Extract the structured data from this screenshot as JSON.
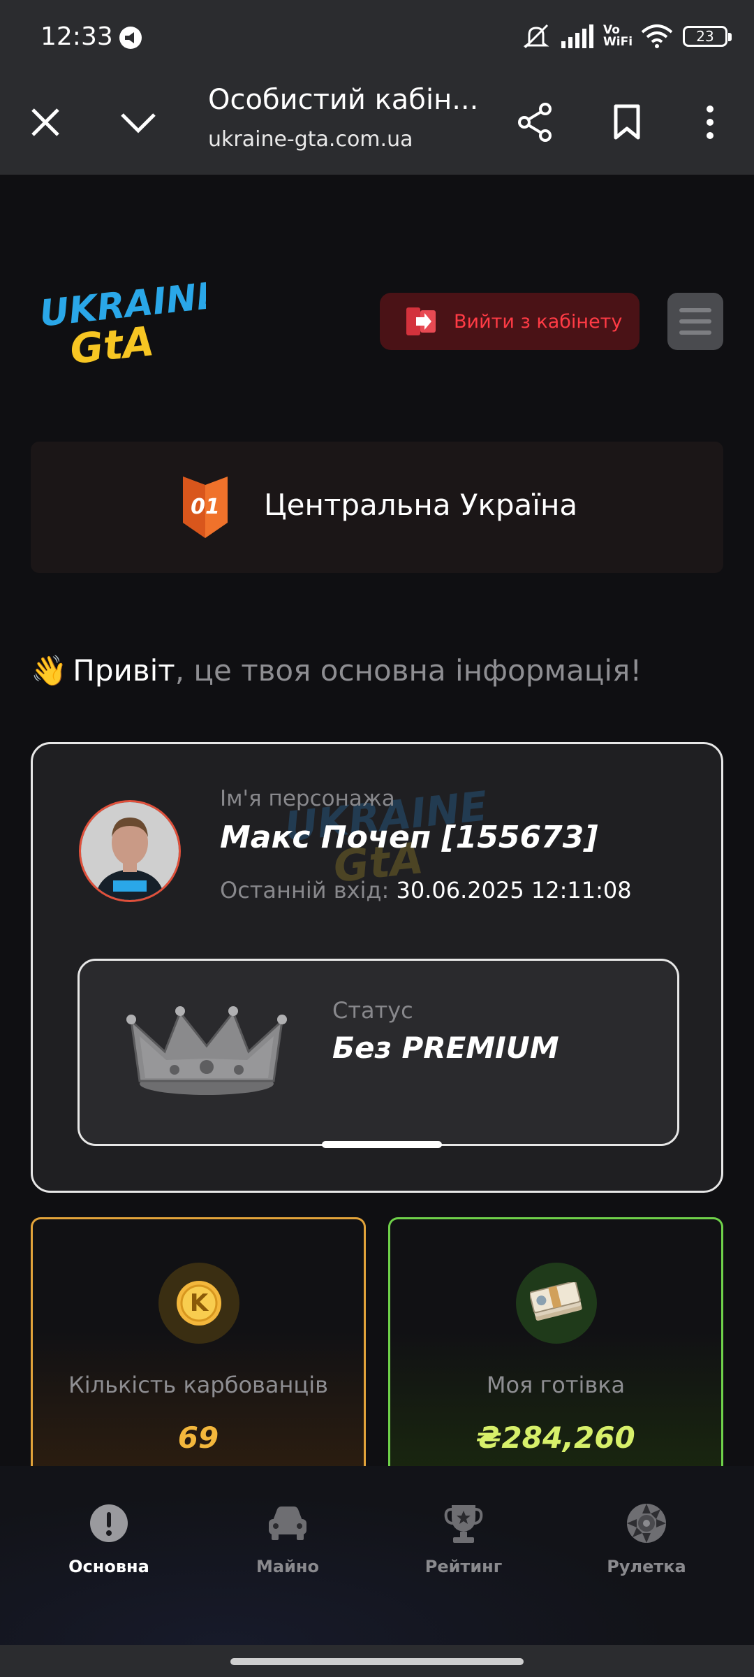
{
  "status_bar": {
    "time": "12:33",
    "battery": "23",
    "network_label": "Vo WiFi"
  },
  "browser": {
    "title": "Особистий кабін...",
    "url": "ukraine-gta.com.ua",
    "icons": [
      "close-icon",
      "chevron-down-icon",
      "share-icon",
      "bookmark-icon",
      "more-vert-icon"
    ]
  },
  "header": {
    "logo_text": [
      "UKRAINE",
      "GTA"
    ],
    "logout_label": "Вийти з кабінету",
    "logout_color": "#ff3b45"
  },
  "server": {
    "badge_number": "01",
    "name": "Центральна Україна"
  },
  "greeting": {
    "emoji": "👋",
    "strong": "Привіт",
    "rest": ", це твоя основна інформація!"
  },
  "profile": {
    "character_label": "Ім'я персонажа",
    "character_name": "Макс Почеп [155673]",
    "last_login_label": "Останній вхід:",
    "last_login_value": "30.06.2025 12:11:08",
    "status_label": "Статус",
    "status_value": "Без PREMIUM"
  },
  "stats": {
    "karbovantsi": {
      "label": "Кількість карбованців",
      "value": "69",
      "icon_letter": "K",
      "accent": "#e2a33a"
    },
    "cash": {
      "label": "Моя готівка",
      "value": "₴284,260",
      "accent": "#6fd14a"
    }
  },
  "bottom_nav": {
    "items": [
      {
        "label": "Основна",
        "icon": "info-icon",
        "active": true
      },
      {
        "label": "Майно",
        "icon": "car-icon",
        "active": false
      },
      {
        "label": "Рейтинг",
        "icon": "trophy-icon",
        "active": false
      },
      {
        "label": "Рулетка",
        "icon": "roulette-icon",
        "active": false
      }
    ]
  }
}
